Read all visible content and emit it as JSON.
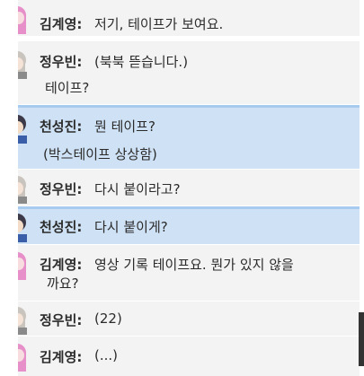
{
  "messages": [
    {
      "speaker": "김계영:",
      "text": "저기, 테이프가 보여요.",
      "avatar": "pink-hair-avatar-icon"
    },
    {
      "speaker": "정우빈:",
      "text": "(북북 뜯습니다.)",
      "text2": "테이프?",
      "avatar": "gray-hair-avatar-icon"
    },
    {
      "speaker": "천성진:",
      "text": "뭔 테이프?",
      "text2": "(박스테이프 상상함)",
      "avatar": "dark-hair-avatar-icon"
    },
    {
      "speaker": "정우빈:",
      "text": "다시 붙이라고?",
      "avatar": "gray-hair-avatar-icon"
    },
    {
      "speaker": "천성진:",
      "text": "다시 붙이게?",
      "avatar": "dark-hair-avatar-icon"
    },
    {
      "speaker": "김계영:",
      "text": "영상 기록 테이프요. 뭔가 있지 않을",
      "text2": "까요?",
      "avatar": "pink-hair-avatar-icon"
    },
    {
      "speaker": "정우빈:",
      "text": "(22)",
      "avatar": "gray-hair-avatar-icon"
    },
    {
      "speaker": "김계영:",
      "text": "(...)",
      "avatar": "pink-hair-avatar-icon"
    }
  ],
  "colors": {
    "row_background": "#f3f3f3",
    "highlight_background": "#cfe2f5",
    "highlight_border": "#a7cbee",
    "text": "#2b2b2b"
  }
}
